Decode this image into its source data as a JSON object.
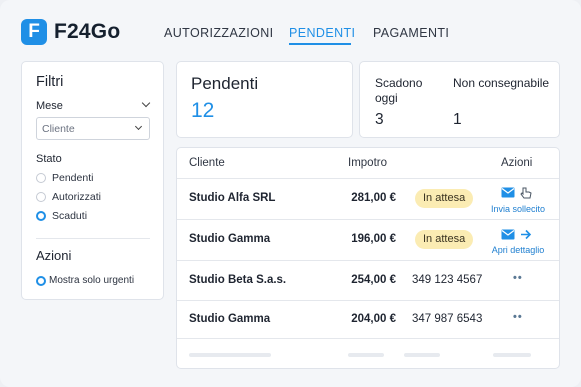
{
  "brand": {
    "logo_letter": "F",
    "name": "F24Go",
    "accent": "#1f8fe6"
  },
  "nav": {
    "tabs": [
      {
        "label": "AUTORIZZAZIONI",
        "active": false
      },
      {
        "label": "PENDENTI",
        "active": true
      },
      {
        "label": "PAGAMENTI",
        "active": false
      }
    ]
  },
  "filters": {
    "title": "Filtri",
    "month_label": "Mese",
    "client_select_value": "Cliente",
    "status_label": "Stato",
    "status_options": [
      {
        "label": "Pendenti",
        "selected": false
      },
      {
        "label": "Autorizzati",
        "selected": false
      },
      {
        "label": "Scaduti",
        "selected": true
      }
    ],
    "actions_title": "Azioni",
    "urgent_only": {
      "label": "Mostra solo urgenti",
      "selected": true
    }
  },
  "stats": {
    "pending": {
      "title": "Pendenti",
      "value": "12"
    },
    "due_today": {
      "label": "Scadono oggi",
      "value": "3"
    },
    "undeliverable": {
      "label": "Non consegnabile",
      "value": "1"
    }
  },
  "table": {
    "headers": {
      "client": "Cliente",
      "amount": "Impotro",
      "actions": "Azioni"
    },
    "rows": [
      {
        "client": "Studio Alfa SRL",
        "amount": "281,00 €",
        "badge": "In attesa",
        "action_label": "Invia sollecito",
        "action_icons": [
          "mail-icon",
          "hand-cursor-icon"
        ]
      },
      {
        "client": "Studio Gamma",
        "amount": "196,00 €",
        "badge": "In attesa",
        "action_label": "Apri dettaglio",
        "action_icons": [
          "mail-icon",
          "arrow-right-icon"
        ]
      },
      {
        "client": "Studio Beta S.a.s.",
        "amount": "254,00 €",
        "phone": "349 123 4567",
        "action_icons": [
          "more-icon"
        ]
      },
      {
        "client": "Studio Gamma",
        "amount": "204,00 €",
        "phone": "347 987 6543",
        "action_icons": [
          "more-icon"
        ]
      }
    ],
    "badge_color": "#fbecb3"
  }
}
